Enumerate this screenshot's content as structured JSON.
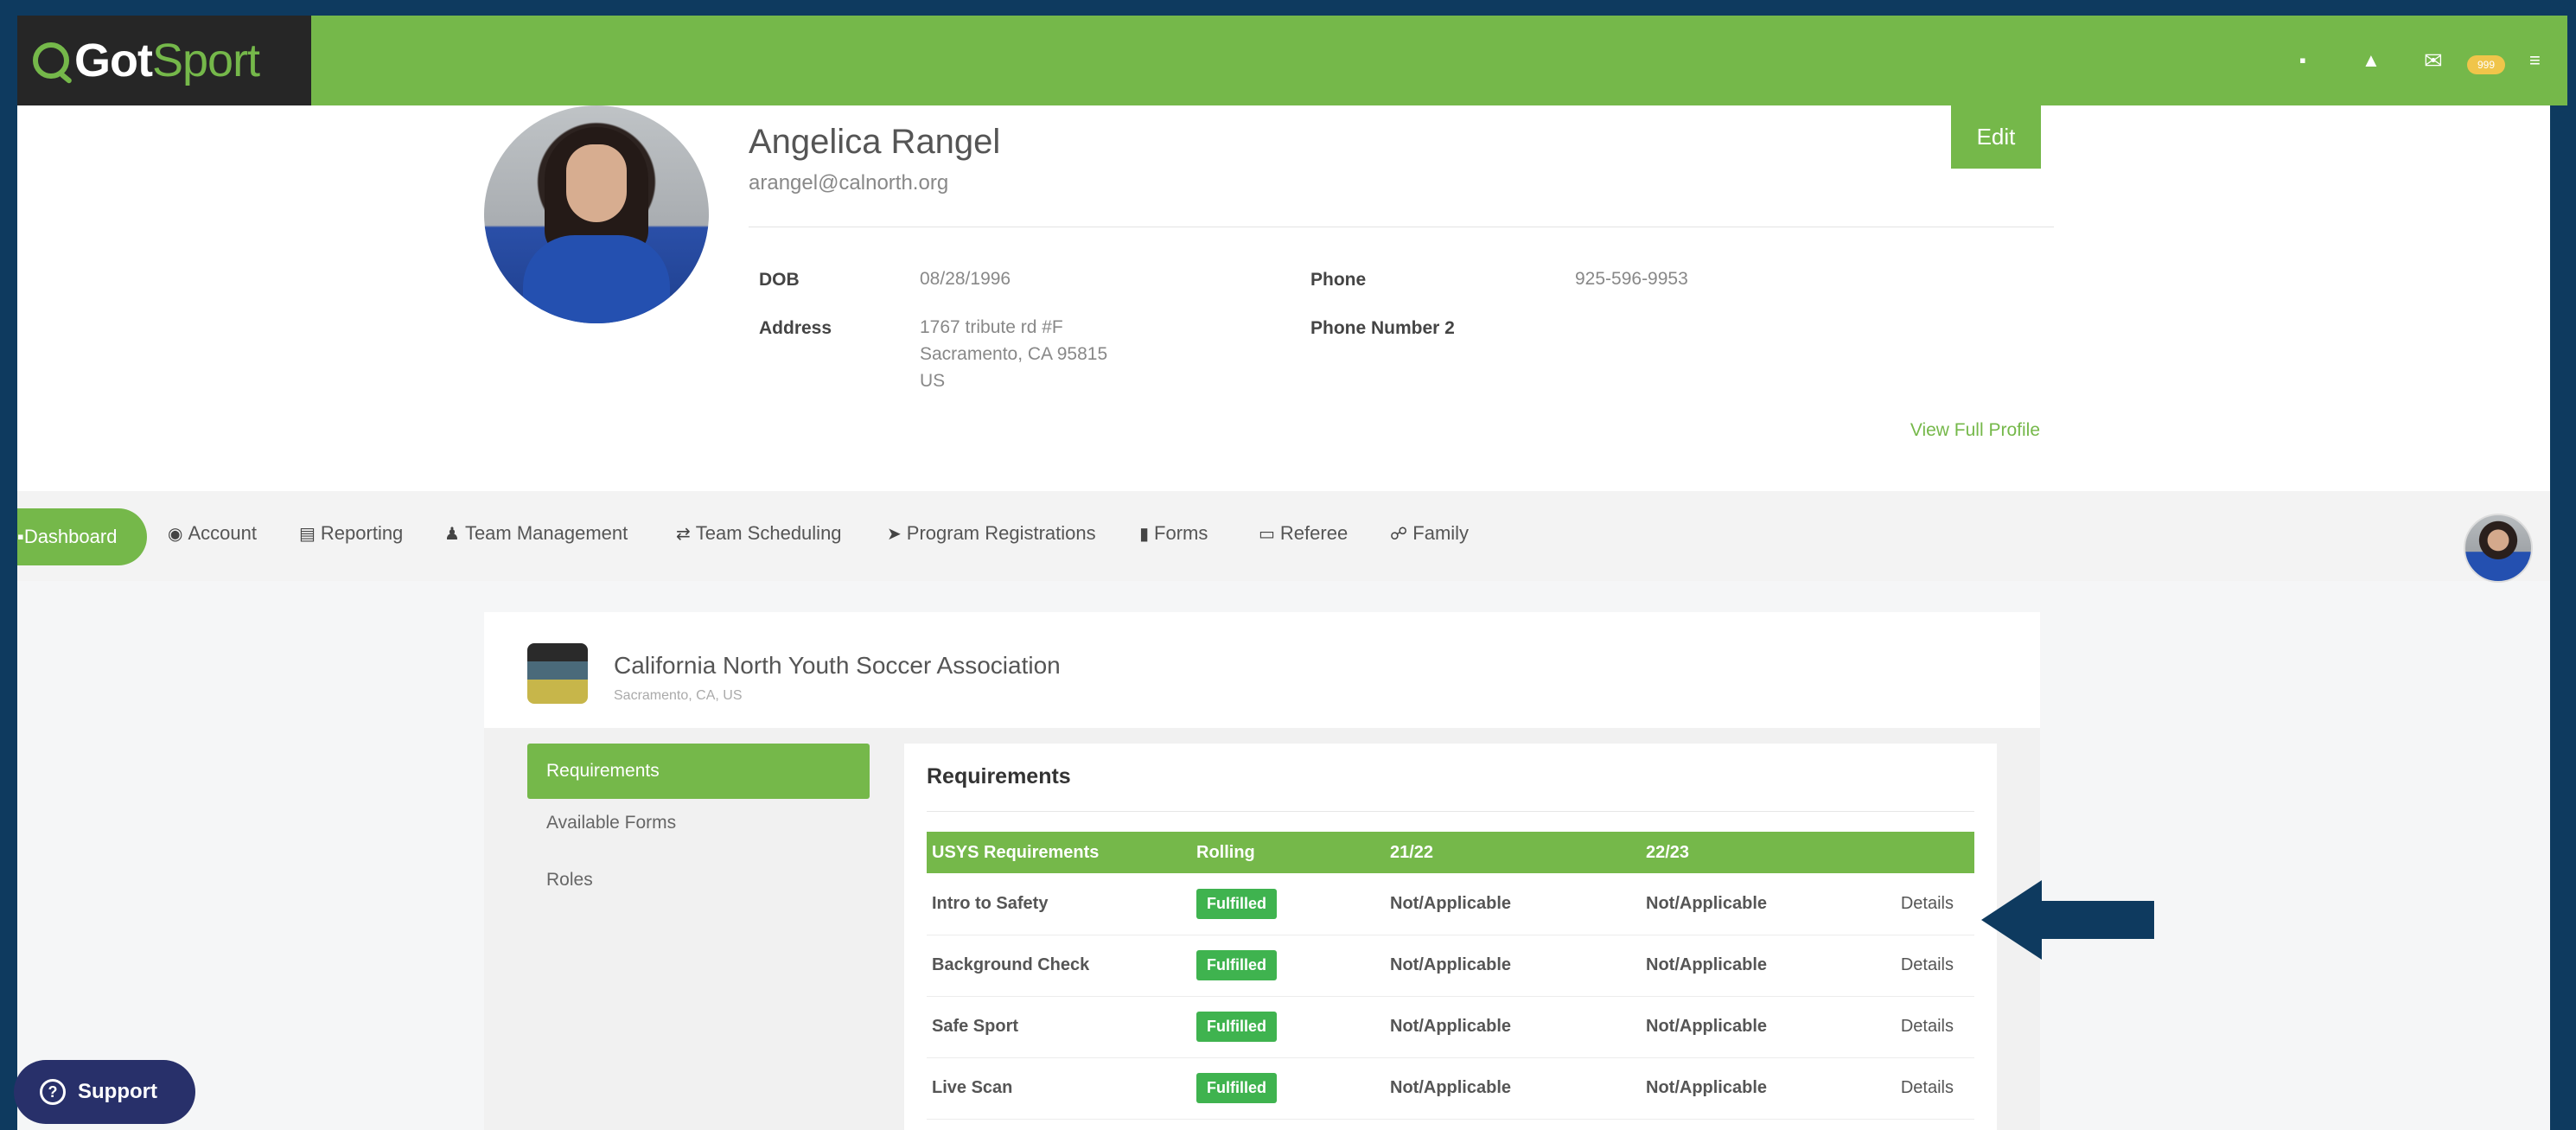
{
  "app": {
    "logo_got": "Got",
    "logo_sport": "Sport",
    "mail_badge": "999"
  },
  "profile": {
    "name": "Angelica Rangel",
    "email": "arangel@calnorth.org",
    "edit_label": "Edit",
    "dob_label": "DOB",
    "dob_value": "08/28/1996",
    "phone_label": "Phone",
    "phone_value": "925-596-9953",
    "address_label": "Address",
    "address_line1": "1767 tribute rd #F",
    "address_line2": "Sacramento, CA 95815",
    "address_line3": "US",
    "phone2_label": "Phone Number 2",
    "view_full_label": "View Full Profile"
  },
  "nav": {
    "dashboard": "Dashboard",
    "account": "Account",
    "reporting": "Reporting",
    "team_management": "Team Management",
    "team_scheduling": "Team Scheduling",
    "program_registrations": "Program Registrations",
    "forms": "Forms",
    "referee": "Referee",
    "family": "Family"
  },
  "org": {
    "name": "California North Youth Soccer Association",
    "location": "Sacramento, CA, US"
  },
  "sidebar": {
    "requirements": "Requirements",
    "available_forms": "Available Forms",
    "roles": "Roles"
  },
  "requirements": {
    "title": "Requirements",
    "headers": [
      "USYS Requirements",
      "Rolling",
      "21/22",
      "22/23",
      ""
    ],
    "rows": [
      {
        "name": "Intro to Safety",
        "rolling": "Fulfilled",
        "y2122": "Not/Applicable",
        "y2223": "Not/Applicable",
        "details": "Details"
      },
      {
        "name": "Background Check",
        "rolling": "Fulfilled",
        "y2122": "Not/Applicable",
        "y2223": "Not/Applicable",
        "details": "Details"
      },
      {
        "name": "Safe Sport",
        "rolling": "Fulfilled",
        "y2122": "Not/Applicable",
        "y2223": "Not/Applicable",
        "details": "Details"
      },
      {
        "name": "Live Scan",
        "rolling": "Fulfilled",
        "y2122": "Not/Applicable",
        "y2223": "Not/Applicable",
        "details": "Details"
      }
    ]
  },
  "support": {
    "label": "Support"
  },
  "colors": {
    "brand_green": "#75b84a",
    "navy": "#0e3a5f",
    "fulfilled_green": "#3fb34f",
    "support_bg": "#28306a"
  }
}
